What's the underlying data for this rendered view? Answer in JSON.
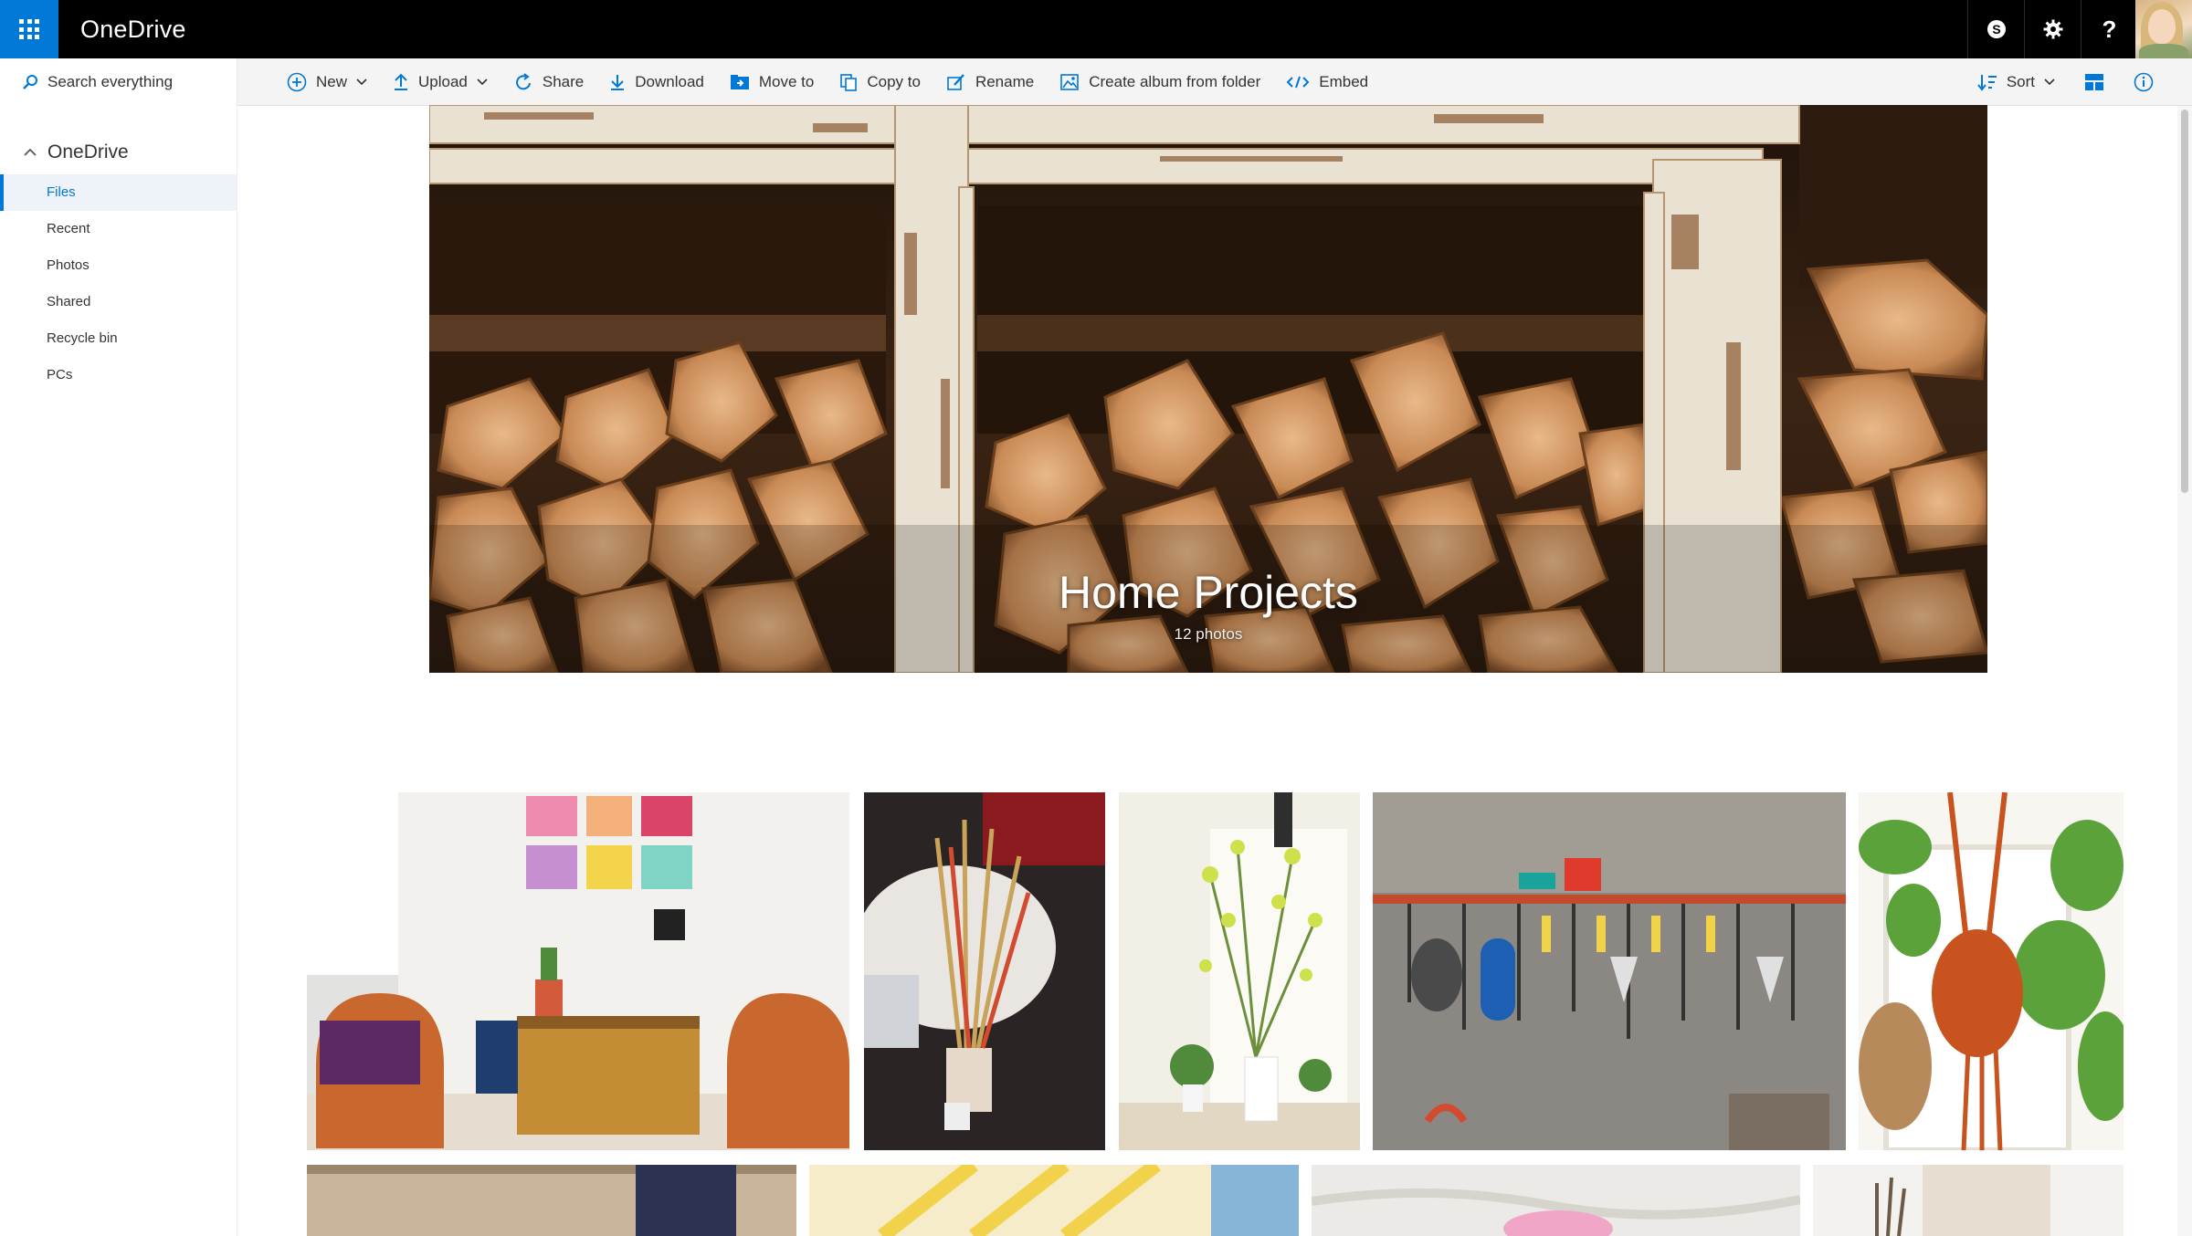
{
  "app": {
    "brand": "OneDrive"
  },
  "suite_icons": [
    "skype-icon",
    "gear-icon",
    "help-icon"
  ],
  "suite_help_glyph": "?",
  "search": {
    "label": "Search everything"
  },
  "commands": [
    {
      "label": "New",
      "icon": "plus-circle-icon",
      "has_menu": true
    },
    {
      "label": "Upload",
      "icon": "upload-icon",
      "has_menu": true
    },
    {
      "label": "Share",
      "icon": "share-icon",
      "has_menu": false
    },
    {
      "label": "Download",
      "icon": "download-icon",
      "has_menu": false
    },
    {
      "label": "Move to",
      "icon": "move-to-icon",
      "has_menu": false
    },
    {
      "label": "Copy to",
      "icon": "copy-to-icon",
      "has_menu": false
    },
    {
      "label": "Rename",
      "icon": "rename-icon",
      "has_menu": false
    },
    {
      "label": "Create album from folder",
      "icon": "album-icon",
      "has_menu": false
    },
    {
      "label": "Embed",
      "icon": "embed-icon",
      "has_menu": false
    }
  ],
  "commands_right": {
    "sort_label": "Sort"
  },
  "nav": {
    "root": "OneDrive",
    "items": [
      {
        "label": "Files",
        "selected": true
      },
      {
        "label": "Recent",
        "selected": false
      },
      {
        "label": "Photos",
        "selected": false
      },
      {
        "label": "Shared",
        "selected": false
      },
      {
        "label": "Recycle bin",
        "selected": false
      },
      {
        "label": "PCs",
        "selected": false
      }
    ]
  },
  "album": {
    "title": "Home Projects",
    "count": "12 photos"
  },
  "colors": {
    "accent": "#0078d7",
    "suitebar": "#000000",
    "cmdbar": "#f4f4f4"
  }
}
